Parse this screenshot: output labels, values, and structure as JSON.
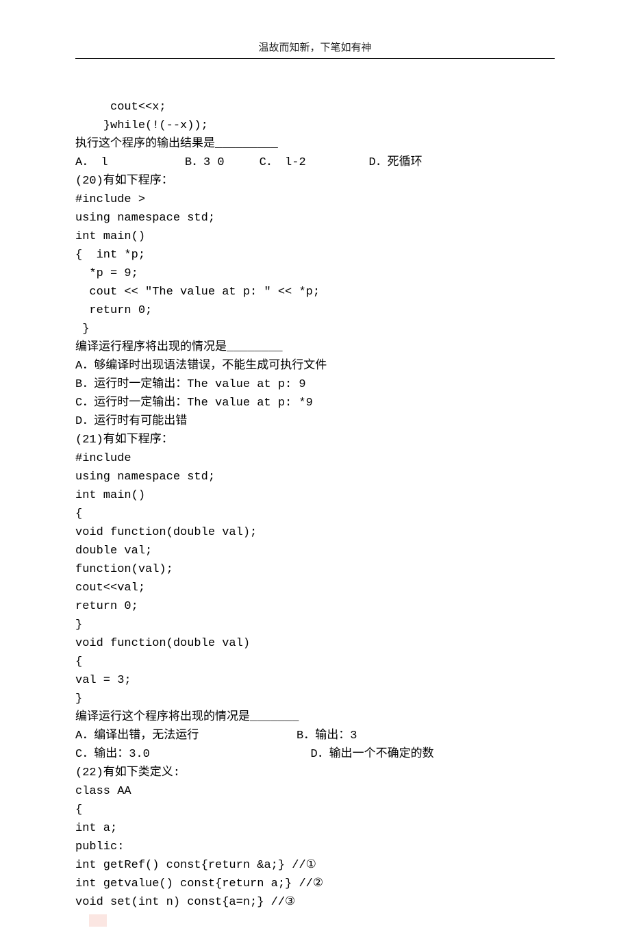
{
  "header": {
    "motto": "温故而知新，下笔如有神"
  },
  "lines": [
    "     cout<<x;",
    "    }while(!(--x));",
    "执行这个程序的输出结果是_________",
    "A． l           B．3 0     C． l-2         D．死循环",
    "(20)有如下程序：",
    "#include >",
    "using namespace std;",
    "int main()",
    "{  int *p;",
    "  *p = 9;",
    "  cout << \"The value at p: \" << *p;",
    "  return 0;",
    " }",
    "编译运行程序将出现的情况是________",
    "A．够编译时出现语法错误，不能生成可执行文件",
    "B．运行时一定输出：The value at p: 9",
    "C．运行时一定输出：The value at p: *9",
    "D．运行时有可能出错",
    "(21)有如下程序：",
    "#include",
    "using namespace std;",
    "int main()",
    "{",
    "void function(double val);",
    "double val;",
    "function(val);",
    "cout<<val;",
    "return 0;",
    "}",
    "void function(double val)",
    "{",
    "val = 3;",
    "}",
    "编译运行这个程序将出现的情况是_______",
    "A．编译出错，无法运行              B．输出：3",
    "C．输出：3.0                       D．输出一个不确定的数",
    "(22)有如下类定义:",
    "class AA",
    "{",
    "int a;",
    "public:",
    "int getRef() const{return &a;} //①",
    "int getvalue() const{return a;} //②",
    "void set(int n) const{a=n;} //③"
  ]
}
